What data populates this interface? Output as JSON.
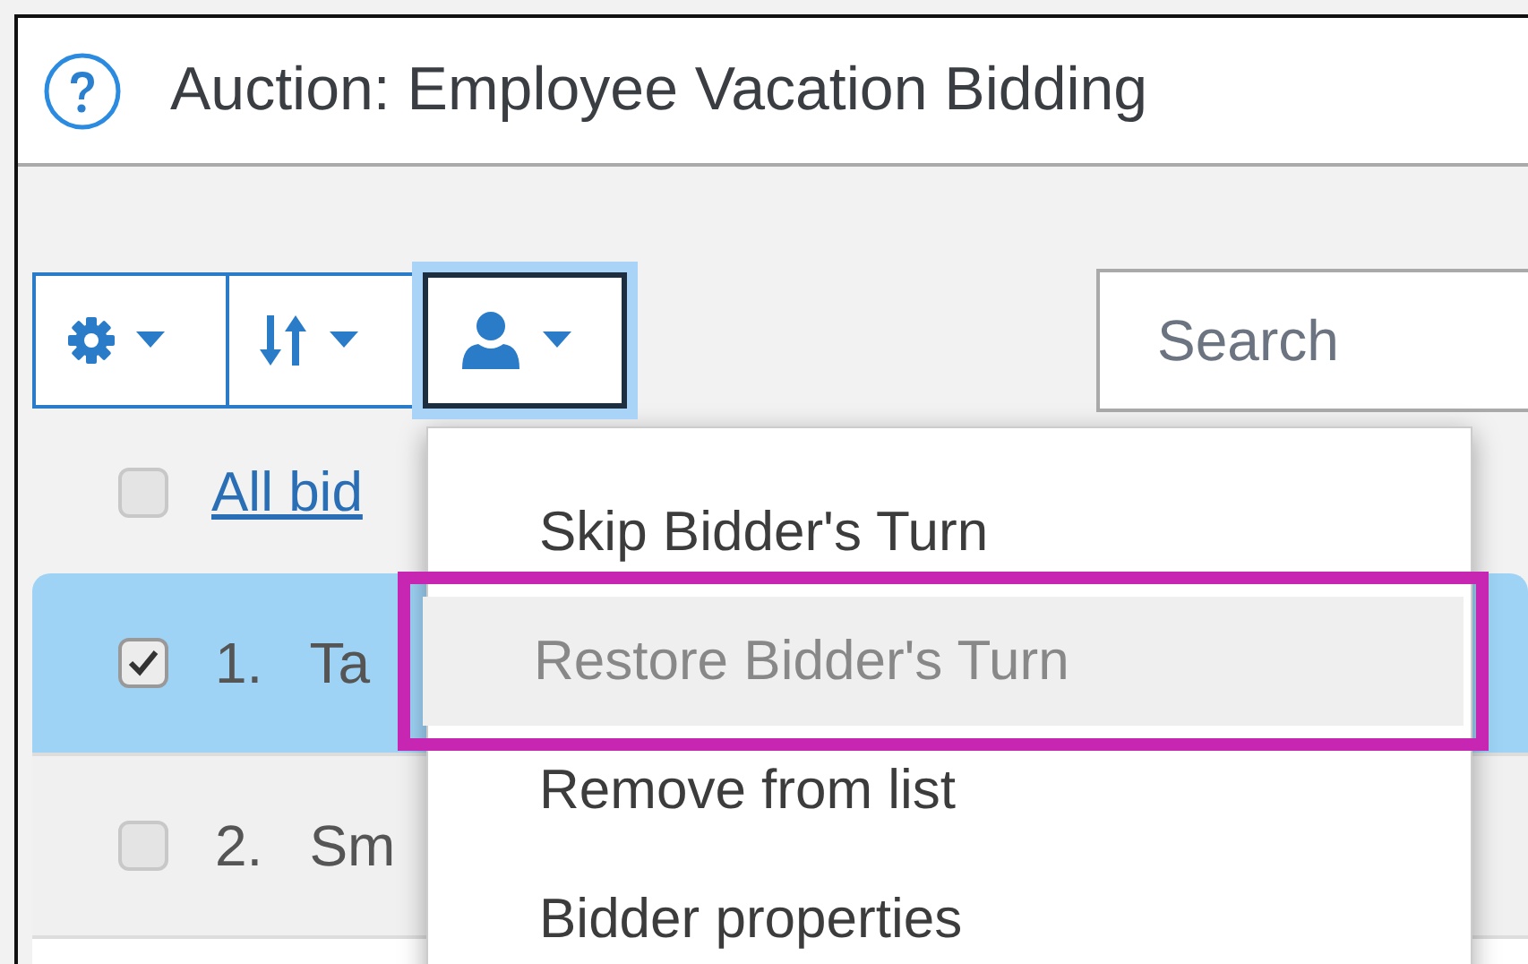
{
  "window": {
    "title": "Auction: Employee Vacation Bidding"
  },
  "toolbar": [
    {
      "kind": "gear",
      "focused": false
    },
    {
      "kind": "sort",
      "focused": false
    },
    {
      "kind": "person",
      "focused": true
    }
  ],
  "search": {
    "placeholder": "Search"
  },
  "select_all": {
    "label": "All bid",
    "checked": false
  },
  "rows": [
    {
      "number": "1.",
      "name": "Ta",
      "checked": true,
      "selected": true
    },
    {
      "number": "2.",
      "name": "Sm",
      "checked": false,
      "selected": false
    },
    {
      "selected": false
    }
  ],
  "menu": [
    {
      "label": "Skip Bidder's Turn",
      "disabled": false,
      "annotated": false
    },
    {
      "label": "Restore Bidder's Turn",
      "disabled": true,
      "annotated": true
    },
    {
      "label": "Remove from list",
      "disabled": false,
      "annotated": false
    },
    {
      "label": "Bidder properties",
      "disabled": false,
      "annotated": false
    }
  ]
}
